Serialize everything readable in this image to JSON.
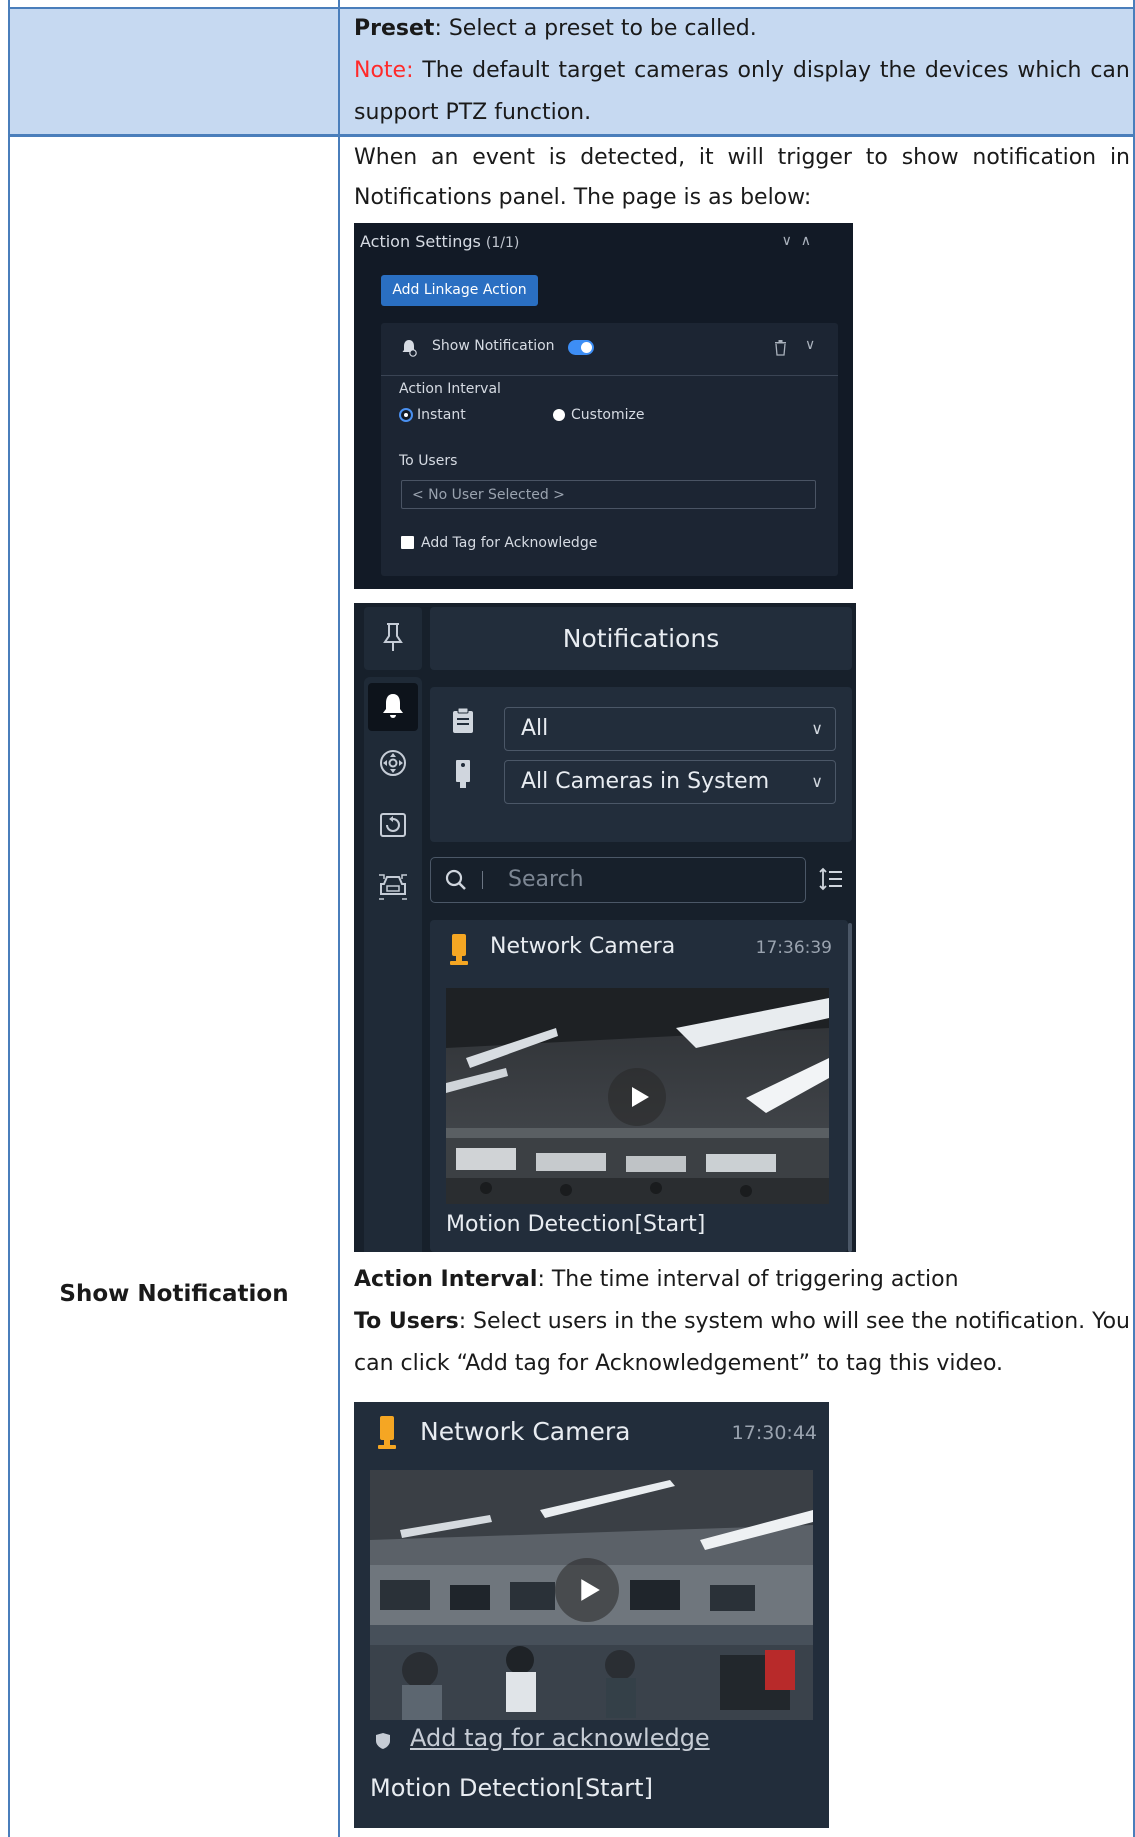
{
  "row1": {
    "preset_term": "Preset",
    "preset_desc": ": Select a preset to be called.",
    "note_label": "Note:",
    "note_words": [
      "The",
      "default",
      "target",
      "cameras",
      "only",
      "display",
      "the",
      "devices",
      "which",
      "can"
    ],
    "note_line2": "support PTZ function."
  },
  "row2": {
    "label": "Show Notification",
    "intro_words": [
      "When",
      "an",
      "event",
      "is",
      "detected,",
      "it",
      "will",
      "trigger",
      "to",
      "show",
      "notification",
      "in"
    ],
    "intro_line2": "Notifications panel. The page is as below:",
    "action_interval_term": "Action Interval",
    "action_interval_desc": ": The time interval of triggering action",
    "to_users_term": "To Users",
    "to_users_words": [
      ":",
      "Select",
      "users",
      "in",
      "the",
      "system",
      "who",
      "will",
      "see",
      "the",
      "notification.",
      "You"
    ],
    "to_users_line2": "can click “Add tag for Acknowledgement” to tag this video."
  },
  "action_settings": {
    "title": "Action Settings",
    "count": "(1/1)",
    "add_button": "Add Linkage Action",
    "card_title": "Show Notification",
    "toggle_on": true,
    "interval_label": "Action Interval",
    "radio_instant": "Instant",
    "radio_customize": "Customize",
    "to_users_label": "To Users",
    "users_value": "< No User Selected >",
    "checkbox_label": "Add Tag for Acknowledge",
    "icons": [
      "bell-check-icon",
      "trash-icon",
      "chevron-down-icon",
      "chevron-up-icon"
    ]
  },
  "notifications_panel": {
    "header": "Notifications",
    "filter_type": "All",
    "filter_camera": "All Cameras in System",
    "search_placeholder": "Search",
    "sidebar_icons": [
      "pin-icon",
      "bell-icon",
      "ptz-icon",
      "playback-icon",
      "vehicle-icon"
    ],
    "item": {
      "camera": "Network Camera",
      "time": "17:36:39",
      "event": "Motion Detection[Start]"
    }
  },
  "notification_card": {
    "camera": "Network Camera",
    "time": "17:30:44",
    "tag_link": "Add tag for acknowledge",
    "event": "Motion Detection[Start]"
  },
  "colors": {
    "border": "#4a7ebb",
    "header_row": "#c6d9f1",
    "note_red": "#ff2a2a",
    "panel_dark": "#17202b",
    "accent_blue": "#2a6fc2",
    "camera_orange": "#f5a623"
  }
}
